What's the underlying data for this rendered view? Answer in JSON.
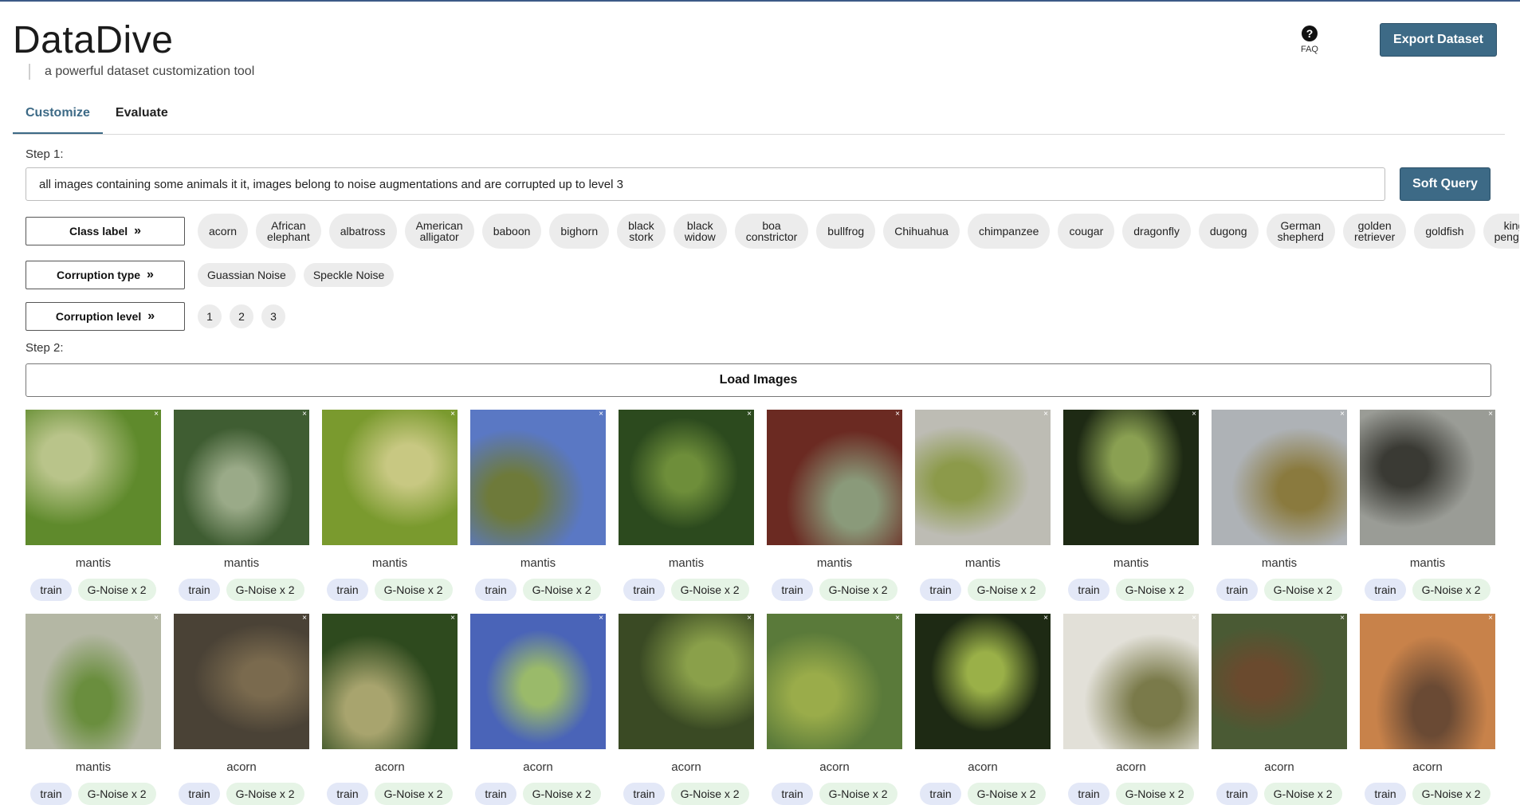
{
  "app": {
    "title": "DataDive",
    "tagline": "a powerful dataset customization tool",
    "faq_label": "FAQ",
    "faq_icon": "?",
    "export_label": "Export Dataset"
  },
  "tabs": [
    {
      "label": "Customize",
      "active": true
    },
    {
      "label": "Evaluate",
      "active": false
    }
  ],
  "step1": {
    "label": "Step 1:",
    "query_value": "all images containing some animals it it, images belong to noise augmentations and are corrupted up to level 3",
    "soft_query_label": "Soft Query"
  },
  "filters": {
    "class_label": {
      "button": "Class label",
      "chevron": "»",
      "options": [
        "acorn",
        "African elephant",
        "albatross",
        "American alligator",
        "baboon",
        "bighorn",
        "black stork",
        "black widow",
        "boa constrictor",
        "bullfrog",
        "Chihuahua",
        "chimpanzee",
        "cougar",
        "dragonfly",
        "dugong",
        "German shepherd",
        "golden retriever",
        "goldfish",
        "king penguin"
      ]
    },
    "corruption_type": {
      "button": "Corruption type",
      "chevron": "»",
      "options": [
        "Guassian Noise",
        "Speckle Noise"
      ]
    },
    "corruption_level": {
      "button": "Corruption level",
      "chevron": "»",
      "options": [
        "1",
        "2",
        "3"
      ]
    }
  },
  "step2": {
    "label": "Step 2:",
    "load_label": "Load Images"
  },
  "images": [
    {
      "label": "mantis",
      "split": "train",
      "aug": "G-Noise x 2",
      "bg": "#5f8a2c",
      "fg": "#b9c48a"
    },
    {
      "label": "mantis",
      "split": "train",
      "aug": "G-Noise x 2",
      "bg": "#3f5d32",
      "fg": "#9aaa88"
    },
    {
      "label": "mantis",
      "split": "train",
      "aug": "G-Noise x 2",
      "bg": "#7a9a2e",
      "fg": "#c8c882"
    },
    {
      "label": "mantis",
      "split": "train",
      "aug": "G-Noise x 2",
      "bg": "#5a78c4",
      "fg": "#6e7a3a"
    },
    {
      "label": "mantis",
      "split": "train",
      "aug": "G-Noise x 2",
      "bg": "#2c4a1e",
      "fg": "#6e8e3a"
    },
    {
      "label": "mantis",
      "split": "train",
      "aug": "G-Noise x 2",
      "bg": "#6b2a22",
      "fg": "#8a9a7a"
    },
    {
      "label": "mantis",
      "split": "train",
      "aug": "G-Noise x 2",
      "bg": "#bdbcb4",
      "fg": "#8c9a4a"
    },
    {
      "label": "mantis",
      "split": "train",
      "aug": "G-Noise x 2",
      "bg": "#1e2a14",
      "fg": "#8aa052"
    },
    {
      "label": "mantis",
      "split": "train",
      "aug": "G-Noise x 2",
      "bg": "#aeb2b6",
      "fg": "#8a7a3e"
    },
    {
      "label": "mantis",
      "split": "train",
      "aug": "G-Noise x 2",
      "bg": "#9a9c96",
      "fg": "#3a3a34"
    },
    {
      "label": "mantis",
      "split": "train",
      "aug": "G-Noise x 2",
      "bg": "#b4b7a4",
      "fg": "#6a8e3e"
    },
    {
      "label": "acorn",
      "split": "train",
      "aug": "G-Noise x 2",
      "bg": "#4a4236",
      "fg": "#7a6a4e"
    },
    {
      "label": "acorn",
      "split": "train",
      "aug": "G-Noise x 2",
      "bg": "#2e4a1e",
      "fg": "#a8a46e"
    },
    {
      "label": "acorn",
      "split": "train",
      "aug": "G-Noise x 2",
      "bg": "#4a64b8",
      "fg": "#9aba6a"
    },
    {
      "label": "acorn",
      "split": "train",
      "aug": "G-Noise x 2",
      "bg": "#3a4a24",
      "fg": "#8aa04a"
    },
    {
      "label": "acorn",
      "split": "train",
      "aug": "G-Noise x 2",
      "bg": "#5a7a3a",
      "fg": "#9aac4a"
    },
    {
      "label": "acorn",
      "split": "train",
      "aug": "G-Noise x 2",
      "bg": "#1e2a14",
      "fg": "#9ab048"
    },
    {
      "label": "acorn",
      "split": "train",
      "aug": "G-Noise x 2",
      "bg": "#e2e0d8",
      "fg": "#7a7a4a"
    },
    {
      "label": "acorn",
      "split": "train",
      "aug": "G-Noise x 2",
      "bg": "#4a5a34",
      "fg": "#6a4a2e"
    },
    {
      "label": "acorn",
      "split": "train",
      "aug": "G-Noise x 2",
      "bg": "#c8824a",
      "fg": "#6a4a34"
    }
  ]
}
